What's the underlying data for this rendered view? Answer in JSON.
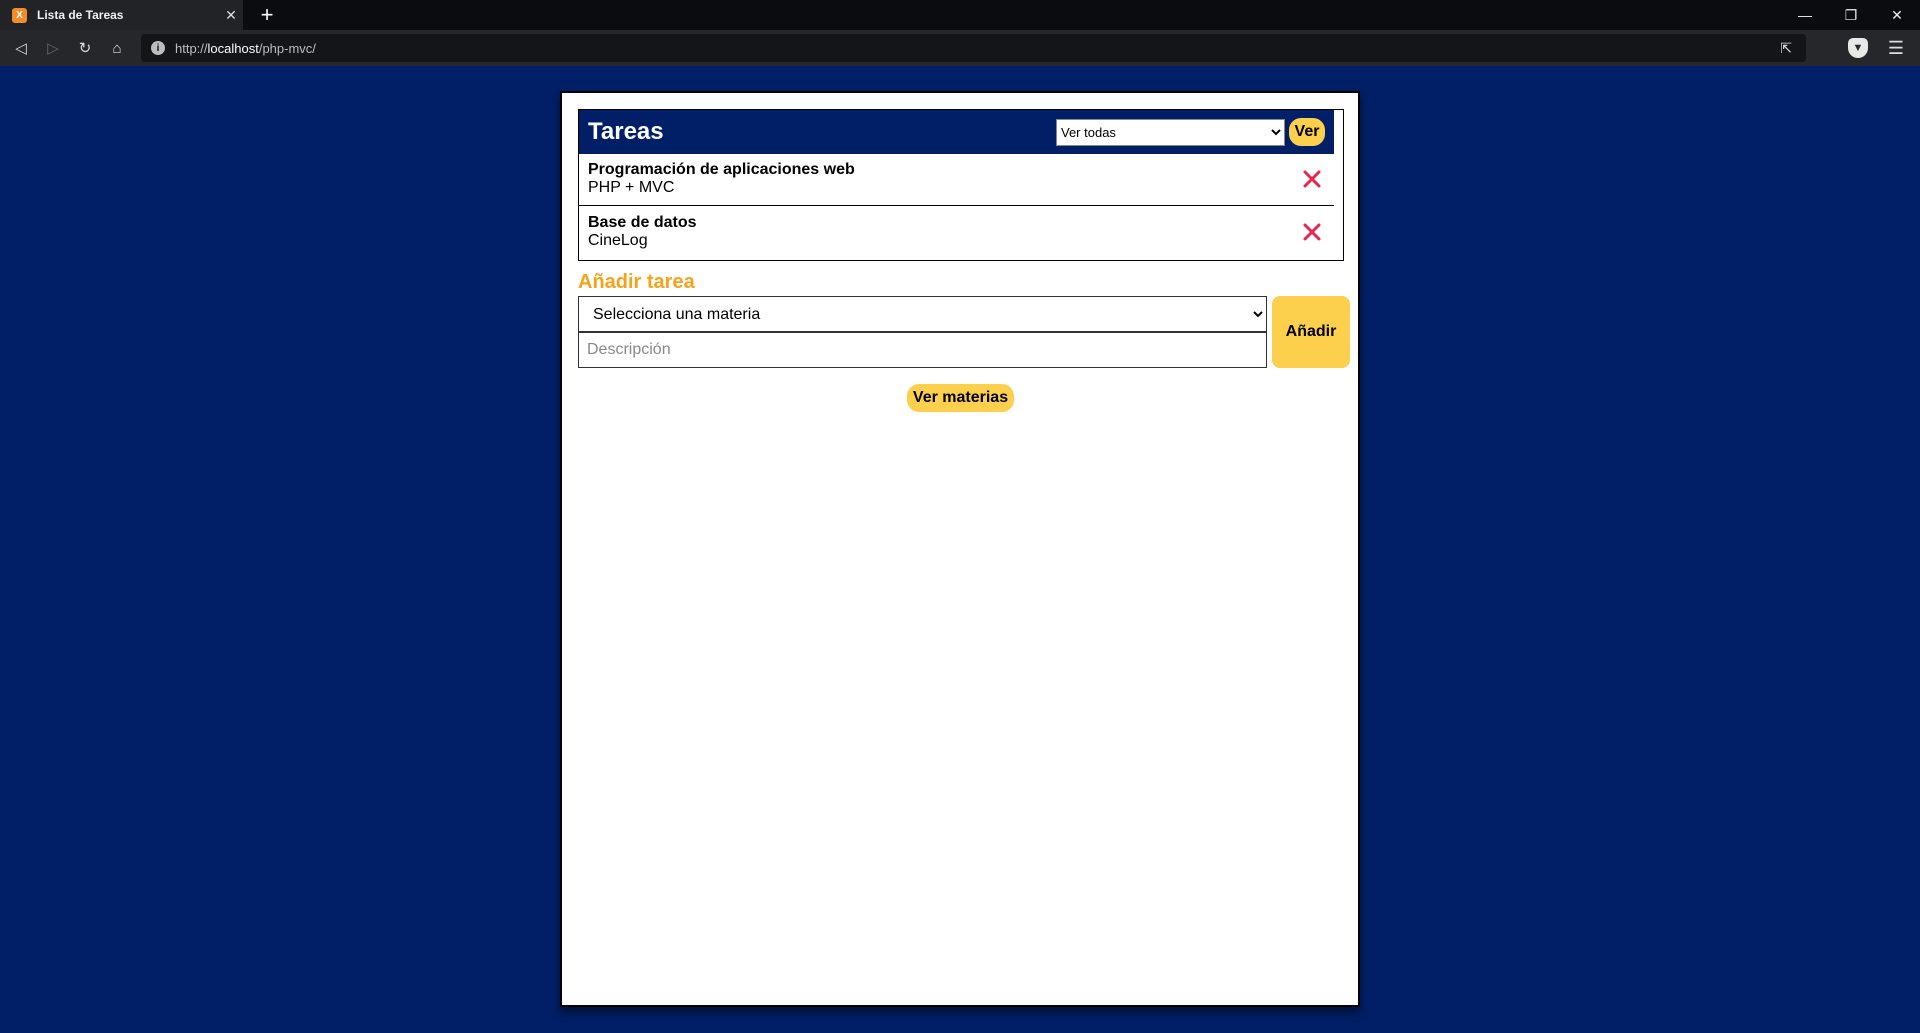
{
  "browser": {
    "tab_title": "Lista de Tareas",
    "tab_favicon": "X",
    "new_tab": "+",
    "url_scheme": "http://",
    "url_host": "localhost",
    "url_path": "/php-mvc/"
  },
  "tasks": {
    "title": "Tareas",
    "filter_selected": "Ver todas",
    "filter_button": "Ver",
    "items": [
      {
        "subject": "Programación de aplicaciones web",
        "description": "PHP + MVC"
      },
      {
        "subject": "Base de datos",
        "description": "CineLog"
      }
    ]
  },
  "add_task": {
    "title": "Añadir tarea",
    "subject_selected": "Selecciona una materia",
    "description_placeholder": "Descripción",
    "add_button": "Añadir"
  },
  "subjects_button": "Ver materias",
  "colors": {
    "background": "#001f66",
    "accent_yellow": "#fccf4d",
    "heading_orange": "#f7a21b",
    "delete_red": "#e8264f"
  }
}
